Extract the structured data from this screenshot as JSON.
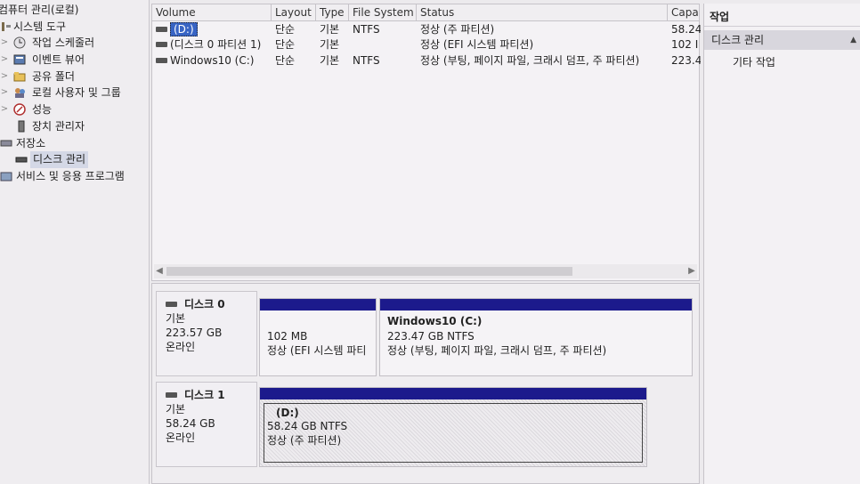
{
  "tree": {
    "root_label": "컴퓨터 관리(로컬)",
    "items": [
      {
        "label": "시스템 도구",
        "icon": "tools-icon",
        "expand": ""
      },
      {
        "label": "작업 스케줄러",
        "icon": "clock-icon",
        "expand": ">"
      },
      {
        "label": "이벤트 뷰어",
        "icon": "event-viewer-icon",
        "expand": ">"
      },
      {
        "label": "공유 폴더",
        "icon": "shared-folder-icon",
        "expand": ">"
      },
      {
        "label": "로컬 사용자 및 그룹",
        "icon": "users-icon",
        "expand": ">"
      },
      {
        "label": "성능",
        "icon": "performance-icon",
        "expand": ">"
      },
      {
        "label": "장치 관리자",
        "icon": "device-manager-icon",
        "expand": ""
      },
      {
        "label": "저장소",
        "icon": "storage-icon",
        "expand": ""
      },
      {
        "label": "디스크 관리",
        "icon": "disk-icon",
        "expand": ""
      },
      {
        "label": "서비스 및 응용 프로그램",
        "icon": "services-icon",
        "expand": ">"
      }
    ]
  },
  "volume_list": {
    "columns": [
      "Volume",
      "Layout",
      "Type",
      "File System",
      "Status",
      "Capa"
    ],
    "rows": [
      {
        "volume": "(D:)",
        "layout": "단순",
        "type": "기본",
        "fs": "NTFS",
        "status": "정상 (주 파티션)",
        "capacity": "58.24"
      },
      {
        "volume": "(디스크 0 파티션 1)",
        "layout": "단순",
        "type": "기본",
        "fs": "",
        "status": "정상 (EFI 시스템 파티션)",
        "capacity": "102 I"
      },
      {
        "volume": "Windows10 (C:)",
        "layout": "단순",
        "type": "기본",
        "fs": "NTFS",
        "status": "정상 (부팅, 페이지 파일, 크래시 덤프, 주 파티션)",
        "capacity": "223.4"
      }
    ]
  },
  "disks": [
    {
      "name": "디스크 0",
      "type": "기본",
      "size": "223.57 GB",
      "state": "온라인",
      "partitions": [
        {
          "title": "",
          "size": "102 MB",
          "status": "정상 (EFI 시스템 파티"
        },
        {
          "title": "Windows10  (C:)",
          "size": "223.47 GB NTFS",
          "status": "정상 (부팅, 페이지 파일, 크래시 덤프, 주 파티션)"
        }
      ]
    },
    {
      "name": "디스크 1",
      "type": "기본",
      "size": "58.24 GB",
      "state": "온라인",
      "partitions": [
        {
          "title": "(D:)",
          "size": "58.24 GB NTFS",
          "status": "정상 (주 파티션)"
        }
      ]
    }
  ],
  "actions": {
    "title": "작업",
    "section": "디스크 관리",
    "item": "기타 작업"
  },
  "colors": {
    "partition_bar": "#1c1a8c",
    "selection": "#3864c4"
  }
}
